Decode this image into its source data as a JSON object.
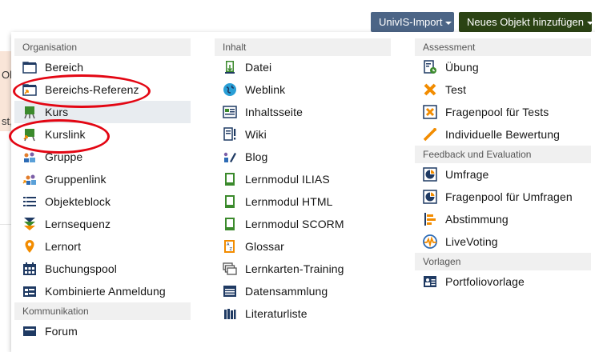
{
  "background_page": {
    "fragment_top": "Ob",
    "fragment_bottom": "st, I"
  },
  "toolbar": {
    "univis_label": "UnivIS-Import",
    "new_object_label": "Neues Objekt hinzufügen"
  },
  "menu": {
    "organisation": {
      "header": "Organisation",
      "items": [
        {
          "label": "Bereich",
          "icon": "category-icon"
        },
        {
          "label": "Bereichs-Referenz",
          "icon": "category-reference-icon"
        },
        {
          "label": "Kurs",
          "icon": "course-icon"
        },
        {
          "label": "Kurslink",
          "icon": "course-link-icon"
        },
        {
          "label": "Gruppe",
          "icon": "group-icon"
        },
        {
          "label": "Gruppenlink",
          "icon": "group-link-icon"
        },
        {
          "label": "Objekteblock",
          "icon": "item-group-icon"
        },
        {
          "label": "Lernsequenz",
          "icon": "learning-sequence-icon"
        },
        {
          "label": "Lernort",
          "icon": "location-pin-icon"
        },
        {
          "label": "Buchungspool",
          "icon": "calendar-icon"
        },
        {
          "label": "Kombinierte Anmeldung",
          "icon": "combined-registration-icon"
        }
      ]
    },
    "kommunikation": {
      "header": "Kommunikation",
      "items": [
        {
          "label": "Forum",
          "icon": "forum-icon"
        }
      ]
    },
    "inhalt": {
      "header": "Inhalt",
      "items": [
        {
          "label": "Datei",
          "icon": "file-icon"
        },
        {
          "label": "Weblink",
          "icon": "weblink-icon"
        },
        {
          "label": "Inhaltsseite",
          "icon": "content-page-icon"
        },
        {
          "label": "Wiki",
          "icon": "wiki-icon"
        },
        {
          "label": "Blog",
          "icon": "blog-icon"
        },
        {
          "label": "Lernmodul ILIAS",
          "icon": "learning-module-icon"
        },
        {
          "label": "Lernmodul HTML",
          "icon": "learning-module-html-icon"
        },
        {
          "label": "Lernmodul SCORM",
          "icon": "learning-module-scorm-icon"
        },
        {
          "label": "Glossar",
          "icon": "glossary-icon"
        },
        {
          "label": "Lernkarten-Training",
          "icon": "flashcards-icon"
        },
        {
          "label": "Datensammlung",
          "icon": "data-collection-icon"
        },
        {
          "label": "Literaturliste",
          "icon": "bibliography-icon"
        }
      ]
    },
    "assessment": {
      "header": "Assessment",
      "items": [
        {
          "label": "Übung",
          "icon": "exercise-icon"
        },
        {
          "label": "Test",
          "icon": "test-icon"
        },
        {
          "label": "Fragenpool für Tests",
          "icon": "question-pool-icon"
        },
        {
          "label": "Individuelle Bewertung",
          "icon": "individual-assessment-icon"
        }
      ]
    },
    "feedback": {
      "header": "Feedback und Evaluation",
      "items": [
        {
          "label": "Umfrage",
          "icon": "survey-icon"
        },
        {
          "label": "Fragenpool für Umfragen",
          "icon": "survey-pool-icon"
        },
        {
          "label": "Abstimmung",
          "icon": "poll-icon"
        },
        {
          "label": "LiveVoting",
          "icon": "live-voting-icon"
        }
      ]
    },
    "vorlagen": {
      "header": "Vorlagen",
      "items": [
        {
          "label": "Portfoliovorlage",
          "icon": "portfolio-template-icon"
        }
      ]
    }
  },
  "colors": {
    "header_bg": "#f0f0f0",
    "univis_button": "#4c6586",
    "new_object_button": "#2b4314",
    "annotation": "#e30613"
  }
}
